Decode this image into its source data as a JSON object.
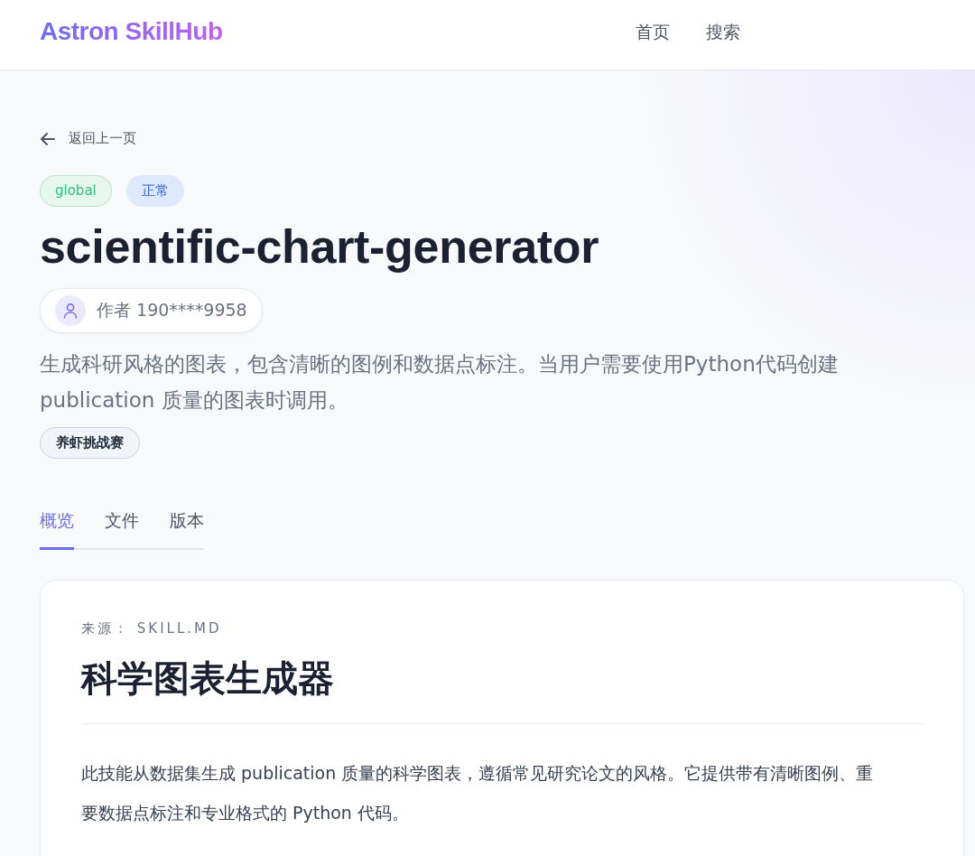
{
  "header": {
    "logo": "Astron SkillHub",
    "nav": [
      {
        "label": "首页"
      },
      {
        "label": "搜索"
      }
    ]
  },
  "back_link": "返回上一页",
  "badges": [
    {
      "label": "global",
      "kind": "scope"
    },
    {
      "label": "正常",
      "kind": "status"
    }
  ],
  "title": "scientific-chart-generator",
  "author": "作者 190****9958",
  "description": "生成科研风格的图表，包含清晰的图例和数据点标注。当用户需要使用Python代码创建publication 质量的图表时调用。",
  "tags": [
    "养虾挑战赛"
  ],
  "tabs": [
    {
      "label": "概览",
      "selected": true
    },
    {
      "label": "文件",
      "selected": false
    },
    {
      "label": "版本",
      "selected": false
    }
  ],
  "card": {
    "source": "来源： SKILL.MD",
    "heading": "科学图表生成器",
    "paragraph": "此技能从数据集生成 publication 质量的科学图表，遵循常见研究论文的风格。它提供带有清晰图例、重要数据点标注和专业格式的 Python 代码。"
  }
}
